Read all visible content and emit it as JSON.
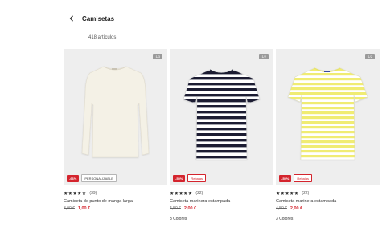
{
  "header": {
    "title": "Camisetas",
    "back_icon": "chevron-left-icon"
  },
  "count": "418 artículos",
  "products": [
    {
      "pager": "1/3",
      "discount": "-66%",
      "tag": "PERSONALIZABLE",
      "stars": "★★★★★",
      "reviews": "(39)",
      "name": "Camiseta de punto de manga larga",
      "old_price": "3,00 €",
      "price": "1,00 €",
      "colors": "",
      "image_bg": "#eeeeee",
      "shirt_color": "#f4f1e6"
    },
    {
      "pager": "1/2",
      "discount": "-55%",
      "tag": "Rebajas",
      "stars": "★★★★★",
      "reviews": "(22)",
      "name": "Camiseta marinera estampada",
      "old_price": "4,50 €",
      "price": "2,00 €",
      "colors": "3 Colores",
      "image_bg": "#eeeeee",
      "shirt_color": "#ffffff",
      "stripe_color": "#1c1f33"
    },
    {
      "pager": "1/2",
      "discount": "-55%",
      "tag": "Rebajas",
      "stars": "★★★★★",
      "reviews": "(22)",
      "name": "Camiseta marinera estampada",
      "old_price": "4,50 €",
      "price": "2,00 €",
      "colors": "3 Colores",
      "image_bg": "#eeeeee",
      "shirt_color": "#ffffff",
      "stripe_color": "#f0ec73"
    }
  ],
  "accent_color": "#d4242d"
}
